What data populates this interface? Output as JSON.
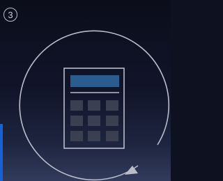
{
  "step": {
    "number": "3"
  },
  "icon": {
    "name": "calculator-icon",
    "cycle_indicator": "circular-arrow-icon"
  },
  "colors": {
    "background_top": "#0b0d1a",
    "background_bottom": "#323b5b",
    "outline": "#b9bdcb",
    "display": "#2b5c8e",
    "keys": "#3a3f52",
    "accent": "#1561d8"
  }
}
